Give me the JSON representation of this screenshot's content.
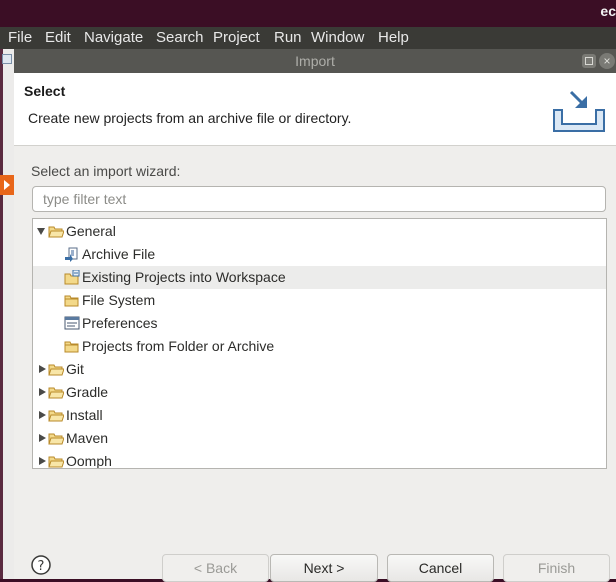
{
  "system_bar": {
    "title": "ec"
  },
  "menu": [
    "File",
    "Edit",
    "Navigate",
    "Search",
    "Project",
    "Run",
    "Window",
    "Help"
  ],
  "dialog": {
    "title": "Import",
    "header_title": "Select",
    "header_description": "Create new projects from an archive file or directory.",
    "filter_label": "Select an import wizard:",
    "filter_placeholder": "type filter text",
    "tree": [
      {
        "label": "General",
        "level": 0,
        "expanded": true,
        "icon": "folder-open-icon"
      },
      {
        "label": "Archive File",
        "level": 1,
        "icon": "archive-file-icon"
      },
      {
        "label": "Existing Projects into Workspace",
        "level": 1,
        "icon": "existing-projects-icon",
        "selected": true
      },
      {
        "label": "File System",
        "level": 1,
        "icon": "folder-icon"
      },
      {
        "label": "Preferences",
        "level": 1,
        "icon": "preferences-icon"
      },
      {
        "label": "Projects from Folder or Archive",
        "level": 1,
        "icon": "folder-icon"
      },
      {
        "label": "Git",
        "level": 0,
        "expanded": false,
        "icon": "folder-open-icon"
      },
      {
        "label": "Gradle",
        "level": 0,
        "expanded": false,
        "icon": "folder-open-icon"
      },
      {
        "label": "Install",
        "level": 0,
        "expanded": false,
        "icon": "folder-open-icon"
      },
      {
        "label": "Maven",
        "level": 0,
        "expanded": false,
        "icon": "folder-open-icon"
      },
      {
        "label": "Oomph",
        "level": 0,
        "expanded": false,
        "icon": "folder-open-icon"
      }
    ],
    "buttons": {
      "back": "< Back",
      "next": "Next >",
      "cancel": "Cancel",
      "finish": "Finish"
    },
    "help_icon": "help-icon"
  }
}
